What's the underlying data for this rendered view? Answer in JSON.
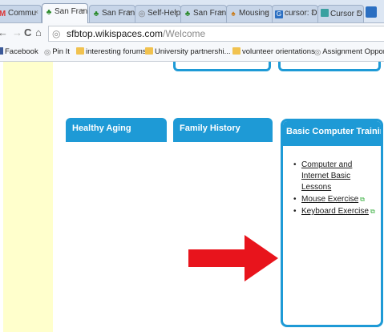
{
  "browser": {
    "tabs": [
      {
        "label": "Commu",
        "icon": "gmail-icon"
      },
      {
        "label": "San Fran",
        "icon": "palm-tree-icon",
        "active": true
      },
      {
        "label": "San Fran",
        "icon": "palm-tree-icon"
      },
      {
        "label": "Self-Help",
        "icon": "globe-icon"
      },
      {
        "label": "San Fran",
        "icon": "palm-tree-icon"
      },
      {
        "label": "Mousing",
        "icon": "palm-tree-icon"
      },
      {
        "label": "cursor: D",
        "icon": "search-icon"
      },
      {
        "label": "Cursor D",
        "icon": "folder-icon"
      }
    ],
    "url_host": "sfbtop.wikispaces.com",
    "url_path": "/Welcome",
    "bookmarks": [
      {
        "label": "Facebook",
        "icon": "facebook-icon"
      },
      {
        "label": "Pin It",
        "icon": "globe-icon"
      },
      {
        "label": "interesting forums",
        "icon": "folder-icon"
      },
      {
        "label": "University partnershi...",
        "icon": "folder-icon"
      },
      {
        "label": "volunteer orientations",
        "icon": "folder-icon"
      },
      {
        "label": "Assignment Opport...",
        "icon": "globe-icon"
      }
    ]
  },
  "page": {
    "cards": [
      {
        "title": "Healthy Aging"
      },
      {
        "title": "Family History"
      },
      {
        "title": "Basic Computer Training"
      }
    ],
    "links": [
      {
        "label": "Computer and Internet Basic Lessons",
        "external": false
      },
      {
        "label": "Mouse Exercise",
        "external": true
      },
      {
        "label": "Keyboard Exercise",
        "external": true
      }
    ]
  },
  "colors": {
    "card_blue": "#1e9ad6",
    "sidebar_yellow": "#ffffcc",
    "arrow_red": "#e8141c"
  }
}
